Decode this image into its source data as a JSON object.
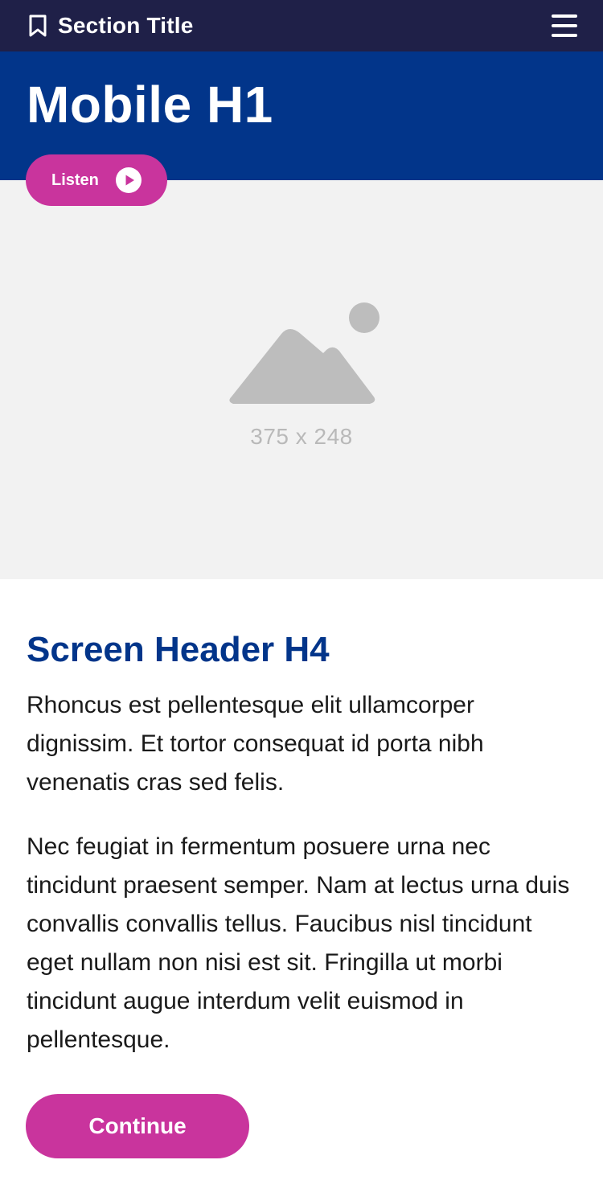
{
  "topbar": {
    "section_title": "Section Title",
    "bookmark_icon": "bookmark-icon",
    "menu_icon": "hamburger-menu-icon",
    "background": "#1f2048"
  },
  "hero": {
    "title": "Mobile H1",
    "background": "#02358a"
  },
  "listen": {
    "label": "Listen",
    "icon": "play-icon",
    "color": "#c9349d"
  },
  "image": {
    "icon": "image-placeholder-icon",
    "dimensions_text": "375 x 248",
    "background": "#f2f2f2"
  },
  "content": {
    "header": "Screen Header H4",
    "header_color": "#02358a",
    "paragraph_1": "Rhoncus est pellentesque elit ullamcorper dignissim. Et tortor consequat id porta nibh venenatis cras sed felis.",
    "paragraph_2": "Nec feugiat in fermentum posuere urna nec tincidunt praesent semper. Nam at lectus urna duis convallis convallis tellus. Faucibus nisl tincidunt eget nullam non nisi est sit. Fringilla ut morbi tincidunt augue interdum velit euismod in pellentesque."
  },
  "actions": {
    "continue_label": "Continue",
    "button_color": "#c9349d"
  }
}
